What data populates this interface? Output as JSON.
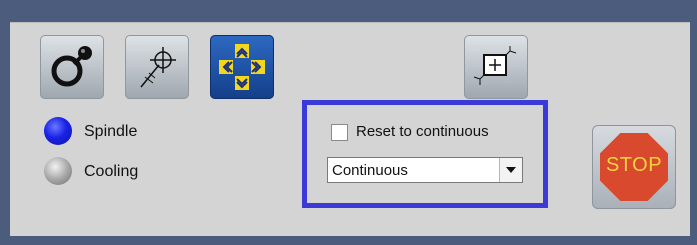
{
  "toolbar": {
    "buttons": [
      {
        "name": "spindle-tool",
        "icon": "spindle-icon"
      },
      {
        "name": "probe-tool",
        "icon": "crosshair-probe-icon"
      },
      {
        "name": "jog-tool",
        "icon": "jog-arrows-icon"
      },
      {
        "name": "workpiece-offset-tool",
        "icon": "workpiece-offset-icon"
      }
    ]
  },
  "status": {
    "spindle_label": "Spindle",
    "spindle_color": "#1a22e6",
    "cooling_label": "Cooling",
    "cooling_color": "#a9a9a9"
  },
  "mode": {
    "reset_label": "Reset to continuous",
    "reset_checked": false,
    "selected": "Continuous",
    "border_color": "#3b3ad6"
  },
  "stop": {
    "label": "STOP",
    "color": "#d8492e",
    "text_color": "#f7d43c"
  }
}
